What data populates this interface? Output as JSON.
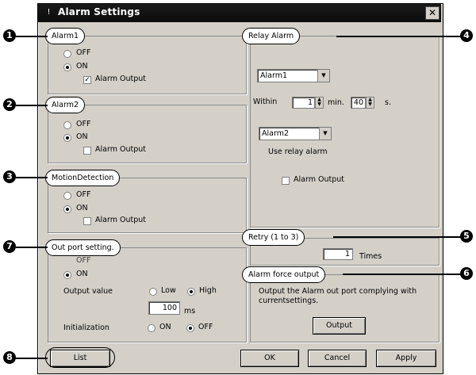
{
  "window": {
    "title": "Alarm Settings",
    "title_icon": "warning-icon",
    "close_glyph": "✕"
  },
  "alarm1": {
    "caption": "Alarm1",
    "off": "OFF",
    "on": "ON",
    "selected": "ON",
    "alarm_output_label": "Alarm Output",
    "alarm_output_checked": true
  },
  "alarm2": {
    "caption": "Alarm2",
    "off": "OFF",
    "on": "ON",
    "selected": "ON",
    "alarm_output_label": "Alarm Output",
    "alarm_output_checked": false
  },
  "motion": {
    "caption": "MotionDetection",
    "off": "OFF",
    "on": "ON",
    "selected": "ON",
    "alarm_output_label": "Alarm Output",
    "alarm_output_checked": false
  },
  "outport": {
    "caption": "Out port setting.",
    "off": "OFF",
    "on": "ON",
    "selected": "ON",
    "output_value_label": "Output value",
    "low": "Low",
    "high": "High",
    "output_value_selected": "High",
    "ms_value": "100",
    "ms_unit": "ms",
    "init_label": "Initialization",
    "init_on": "ON",
    "init_off": "OFF",
    "init_selected": "OFF"
  },
  "relay": {
    "caption": "Relay Alarm",
    "first_select": "Alarm1",
    "within_label": "Within",
    "min_value": "1",
    "min_unit": "min.",
    "sec_value": "40",
    "sec_unit": "s.",
    "second_select": "Alarm2",
    "use_relay_label": "Use relay alarm",
    "alarm_output_label": "Alarm Output",
    "alarm_output_checked": false
  },
  "retry": {
    "caption": "Retry (1 to 3)",
    "value": "1",
    "unit": "Times"
  },
  "force": {
    "caption": "Alarm force output",
    "description": "Output the Alarm out port complying with currentsettings.",
    "button": "Output"
  },
  "footer": {
    "list": "List",
    "ok": "OK",
    "cancel": "Cancel",
    "apply": "Apply"
  },
  "markers": [
    "1",
    "2",
    "3",
    "4",
    "5",
    "6",
    "7",
    "8"
  ]
}
